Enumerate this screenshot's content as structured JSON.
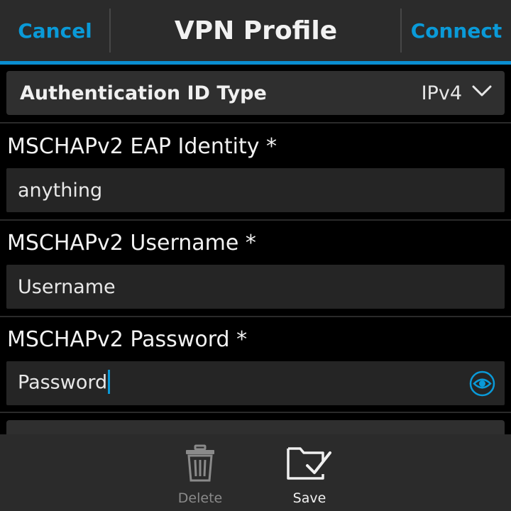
{
  "titlebar": {
    "cancel_label": "Cancel",
    "title": "VPN Profile",
    "connect_label": "Connect"
  },
  "auth_id_type": {
    "label": "Authentication ID Type",
    "value": "IPv4"
  },
  "fields": {
    "eap_identity": {
      "label": "MSCHAPv2 EAP Identity *",
      "value": "anything"
    },
    "username": {
      "label": "MSCHAPv2 Username *",
      "placeholder": "Username"
    },
    "password": {
      "label": "MSCHAPv2 Password *",
      "placeholder": "Password"
    }
  },
  "actions": {
    "delete_label": "Delete",
    "save_label": "Save"
  },
  "colors": {
    "accent": "#0a9ad8",
    "background": "#000000",
    "bar": "#2b2b2b"
  },
  "icons": [
    "chevron-down-icon",
    "eye-icon",
    "trash-icon",
    "folder-check-icon"
  ]
}
